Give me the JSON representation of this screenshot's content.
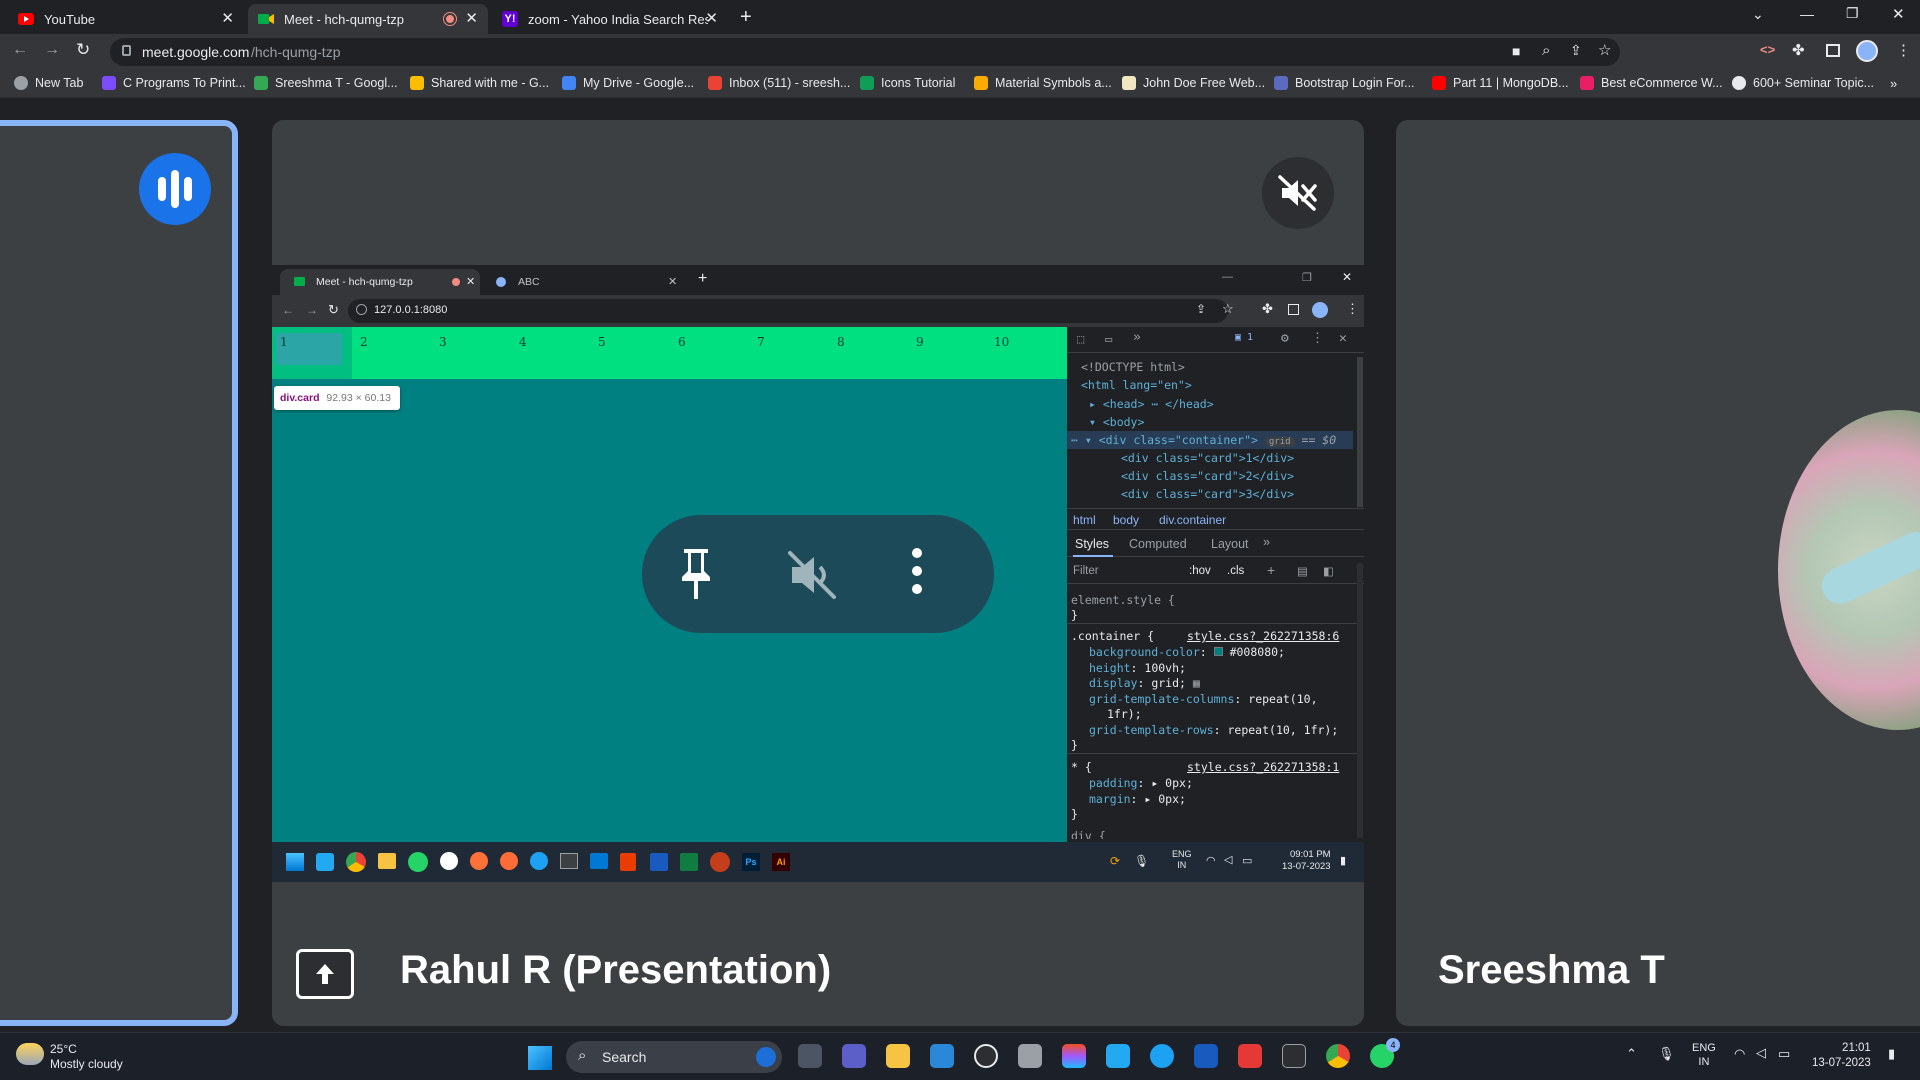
{
  "browser": {
    "tabs": [
      {
        "title": "YouTube",
        "icon": "youtube-icon"
      },
      {
        "title": "Meet - hch-qumg-tzp",
        "icon": "meet-icon",
        "active": true,
        "recording": true
      },
      {
        "title": "zoom - Yahoo India Search Resul",
        "icon": "yahoo-icon"
      }
    ],
    "url_domain": "meet.google.com",
    "url_path": "/hch-qumg-tzp",
    "bookmarks": [
      "New Tab",
      "C Programs To Print...",
      "Sreeshma T - Googl...",
      "Shared with me - G...",
      "My Drive - Google...",
      "Inbox (511) - sreesh...",
      "Icons Tutorial",
      "Material Symbols a...",
      "John Doe Free Web...",
      "Bootstrap Login For...",
      "Part 11 | MongoDB...",
      "Best eCommerce W...",
      "600+ Seminar Topic..."
    ]
  },
  "meet": {
    "presenter_label": "Rahul R (Presentation)",
    "participant_label": "Sreeshma T"
  },
  "shared_screen": {
    "tabs": [
      {
        "title": "Meet - hch-qumg-tzp"
      },
      {
        "title": "ABC"
      }
    ],
    "url": "127.0.0.1:8080",
    "grid_numbers": [
      "1",
      "2",
      "3",
      "4",
      "5",
      "6",
      "7",
      "8",
      "9",
      "10"
    ],
    "tooltip_tag": "div.card",
    "tooltip_size": "92.93 × 60.13",
    "devtools": {
      "issues_count": "1",
      "dom_lines": [
        "<!DOCTYPE html>",
        "<html lang=\"en\">",
        "<head> ⋯ </head>",
        "<body>",
        "<div class=\"container\">",
        "<div class=\"card\">1</div>",
        "<div class=\"card\">2</div>",
        "<div class=\"card\">3</div>"
      ],
      "grid_badge": "grid",
      "dollar_zero": "== $0",
      "breadcrumb": [
        "html",
        "body",
        "div.container"
      ],
      "style_tabs": [
        "Styles",
        "Computed",
        "Layout"
      ],
      "filter_placeholder": "Filter",
      "hov": ":hov",
      "cls": ".cls",
      "css_element_style": "element.style {",
      "css_close": "}",
      "css_container_sel": ".container {",
      "css_container_src": "style.css?_262271358:6",
      "css_rules": [
        {
          "prop": "background-color",
          "value": "#008080;"
        },
        {
          "prop": "height",
          "value": "100vh;"
        },
        {
          "prop": "display",
          "value": "grid;"
        },
        {
          "prop": "grid-template-columns",
          "value": "repeat(10,"
        },
        {
          "prop": "",
          "value": "1fr);"
        },
        {
          "prop": "grid-template-rows",
          "value": "repeat(10, 1fr);"
        }
      ],
      "css_star_sel": "* {",
      "css_star_src": "style.css?_262271358:1",
      "css_star_rules": [
        {
          "prop": "padding",
          "value": "0px;"
        },
        {
          "prop": "margin",
          "value": "0px;"
        }
      ],
      "css_cut": "div {"
    },
    "taskbar": {
      "lang": "ENG",
      "region": "IN",
      "time": "09:01 PM",
      "date": "13-07-2023"
    }
  },
  "taskbar": {
    "weather_temp": "25°C",
    "weather_desc": "Mostly cloudy",
    "search_placeholder": "Search",
    "lang": "ENG",
    "region": "IN",
    "time": "21:01",
    "date": "13-07-2023",
    "whatsapp_badge": "4"
  },
  "colors": {
    "accent_blue": "#8ab4f8",
    "teal_bg": "#008080",
    "grid_green": "#00e080",
    "meet_tile": "#3c4043"
  }
}
